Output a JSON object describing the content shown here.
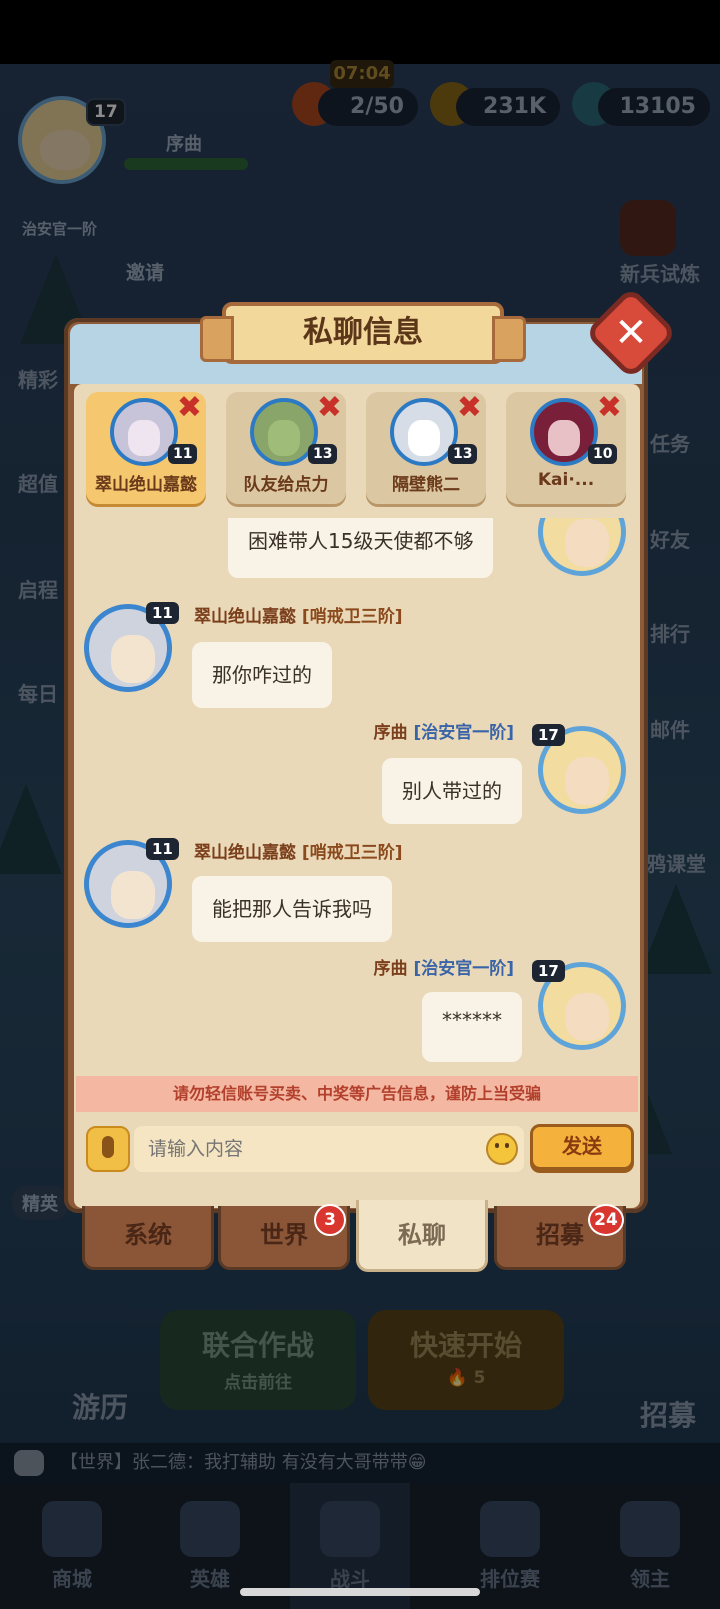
{
  "background": {
    "player_level": "17",
    "stage_label": "序曲",
    "rank_label": "治安官一阶",
    "invite_label": "邀请",
    "timer": "07:04",
    "energy": "2/50",
    "gold": "231K",
    "gems": "13105",
    "newbie_label": "新兵试炼",
    "side_left": [
      "精彩",
      "超值",
      "启程",
      "每日"
    ],
    "side_right": [
      "任务",
      "好友",
      "排行",
      "邮件",
      "鸦课堂"
    ],
    "elite_label": "精英",
    "travel_label": "游历",
    "recruit_label": "招募",
    "coop_title": "联合作战",
    "coop_sub": "点击前往",
    "quick_title": "快速开始",
    "quick_cost": "5",
    "world_chat": "【世界】张二德：我打辅助 有没有大哥带带😁",
    "nav": [
      "商城",
      "英雄",
      "战斗",
      "排位赛",
      "领主"
    ]
  },
  "dialog": {
    "title": "私聊信息",
    "contacts": [
      {
        "name": "翠山绝山嘉懿",
        "level": "11",
        "active": true
      },
      {
        "name": "队友给点力",
        "level": "13",
        "active": false
      },
      {
        "name": "隔壁熊二",
        "level": "13",
        "active": false
      },
      {
        "name": "Kai·...",
        "level": "10",
        "active": false
      }
    ],
    "messages": [
      {
        "side": "right",
        "text": "困难带人15级天使都不够"
      },
      {
        "side": "left",
        "sender": "翠山绝山嘉懿",
        "rank": "[哨戒卫三阶]",
        "level": "11",
        "text": "那你咋过的"
      },
      {
        "side": "right",
        "sender": "序曲",
        "rank": "[治安官一阶]",
        "level": "17",
        "text": "别人带过的"
      },
      {
        "side": "left",
        "sender": "翠山绝山嘉懿",
        "rank": "[哨戒卫三阶]",
        "level": "11",
        "text": "能把那人告诉我吗"
      },
      {
        "side": "right",
        "sender": "序曲",
        "rank": "[治安官一阶]",
        "level": "17",
        "text": "******"
      }
    ],
    "warning": "请勿轻信账号买卖、中奖等广告信息，谨防上当受骗",
    "input_placeholder": "请输入内容",
    "send_label": "发送",
    "channels": [
      {
        "label": "系统",
        "badge": ""
      },
      {
        "label": "世界",
        "badge": "3"
      },
      {
        "label": "私聊",
        "badge": ""
      },
      {
        "label": "招募",
        "badge": "24"
      }
    ]
  },
  "colors": {
    "accent": "#f4b23c",
    "warning_text": "#b2402c",
    "close": "#d84a3a"
  }
}
